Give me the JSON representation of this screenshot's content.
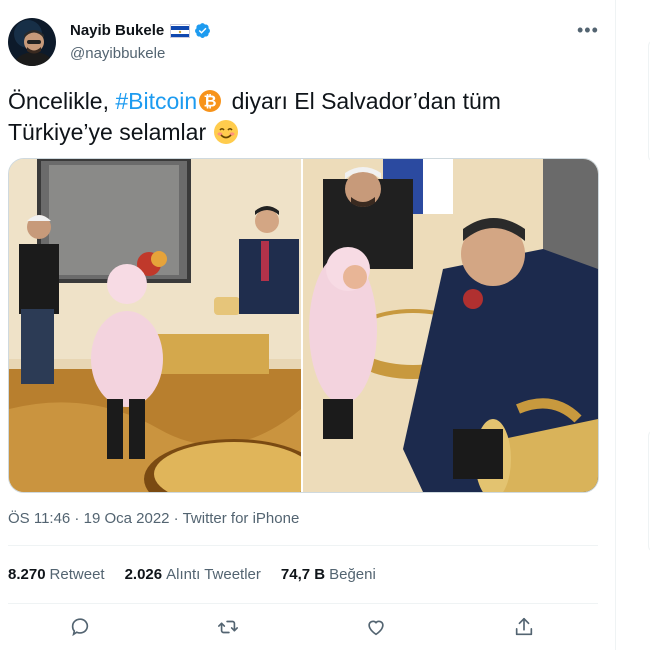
{
  "author": {
    "name": "Nayib Bukele",
    "handle": "@nayibbukele",
    "flag_icon": "el-salvador-flag-icon",
    "verified_icon": "verified-badge-icon"
  },
  "tweet": {
    "text_part1": "Öncelikle, ",
    "hashtag": "#Bitcoin",
    "text_part2": " diyarı El Salvador’dan tüm",
    "text_line2": "Türkiye’ye selamlar "
  },
  "meta": {
    "time": "ÖS 11:46",
    "sep1": " · ",
    "date": "19 Oca 2022",
    "sep2": " · ",
    "source": "Twitter for iPhone"
  },
  "stats": {
    "retweets_count": "8.270",
    "retweets_label": "Retweet",
    "quotes_count": "2.026",
    "quotes_label": "Alıntı Tweetler",
    "likes_count": "74,7 B",
    "likes_label": "Beğeni"
  },
  "colors": {
    "accent": "#1d9bf0",
    "text": "#0f1419",
    "secondary": "#536471",
    "bitcoin": "#f7931a"
  }
}
